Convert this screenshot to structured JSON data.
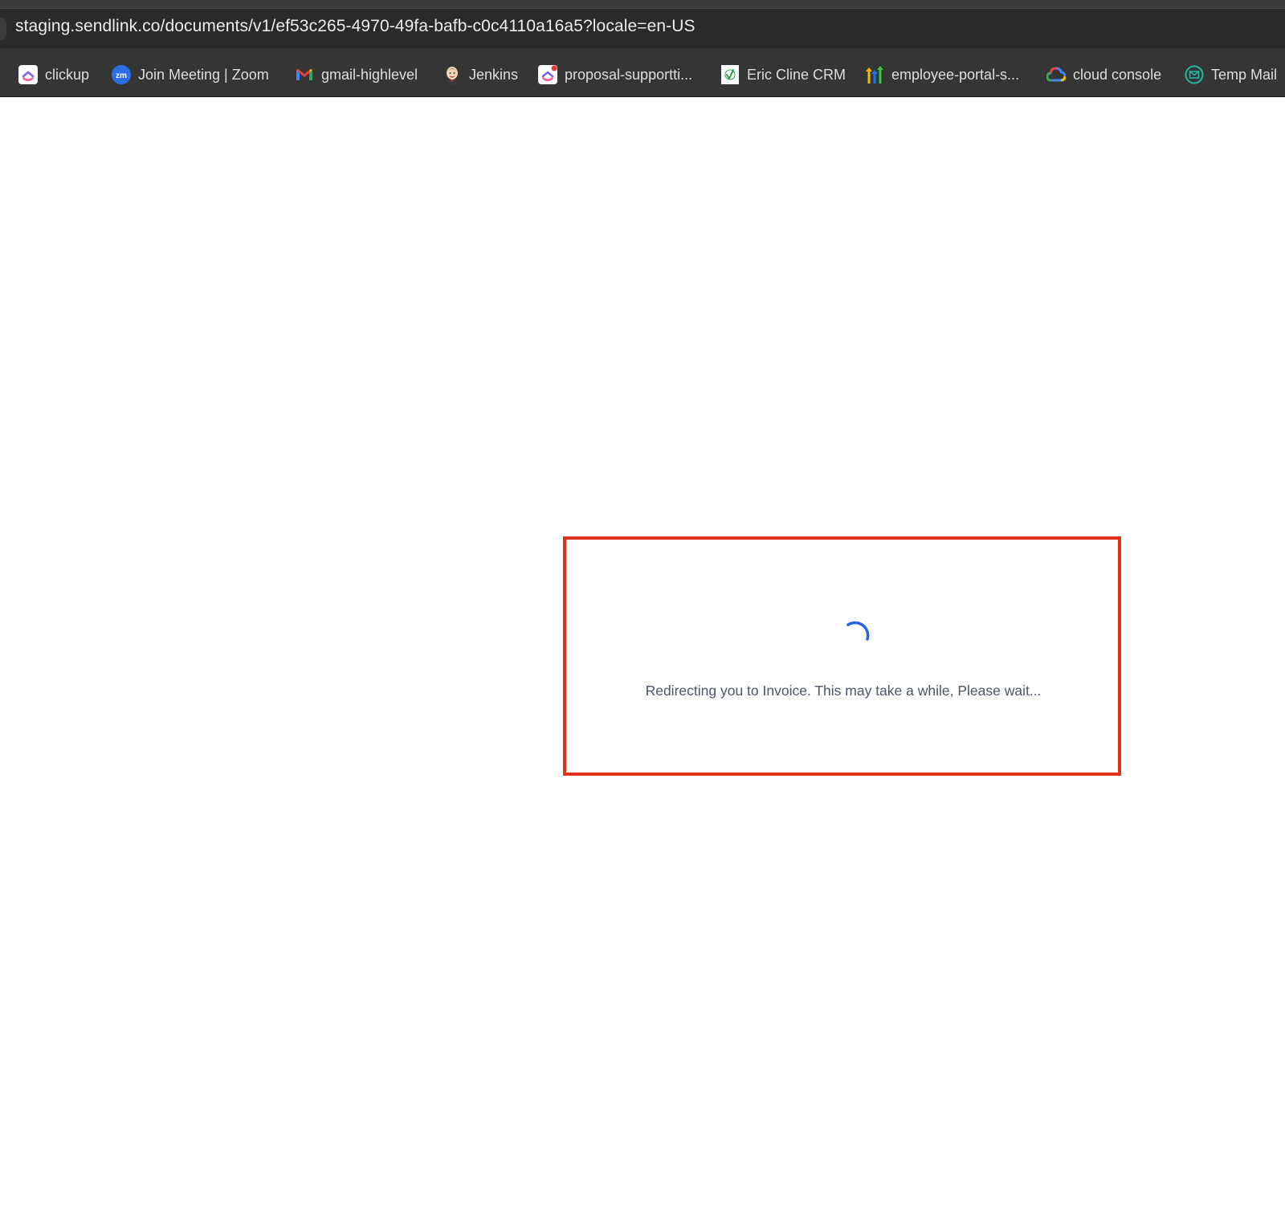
{
  "browser": {
    "url": "staging.sendlink.co/documents/v1/ef53c265-4970-49fa-bafb-c0c4110a16a5?locale=en-US"
  },
  "bookmarks": [
    {
      "label": "clickup",
      "icon": "clickup-icon"
    },
    {
      "label": "Join Meeting | Zoom",
      "icon": "zoom-icon"
    },
    {
      "label": "gmail-highlevel",
      "icon": "gmail-icon"
    },
    {
      "label": "Jenkins",
      "icon": "jenkins-icon"
    },
    {
      "label": "proposal-supportti...",
      "icon": "clickup-icon"
    },
    {
      "label": "Eric Cline CRM",
      "icon": "checkmark-document-icon"
    },
    {
      "label": "employee-portal-s...",
      "icon": "highlevel-icon"
    },
    {
      "label": "cloud console",
      "icon": "google-cloud-icon"
    },
    {
      "label": "Temp Mail",
      "icon": "temp-mail-icon"
    }
  ],
  "page": {
    "loading_message": "Redirecting you to Invoice. This may take a while, Please wait..."
  },
  "colors": {
    "highlight_border": "#e1321c",
    "spinner": "#2563eb",
    "message_text": "#4d5566",
    "chrome_bg": "#2f2f2f"
  }
}
